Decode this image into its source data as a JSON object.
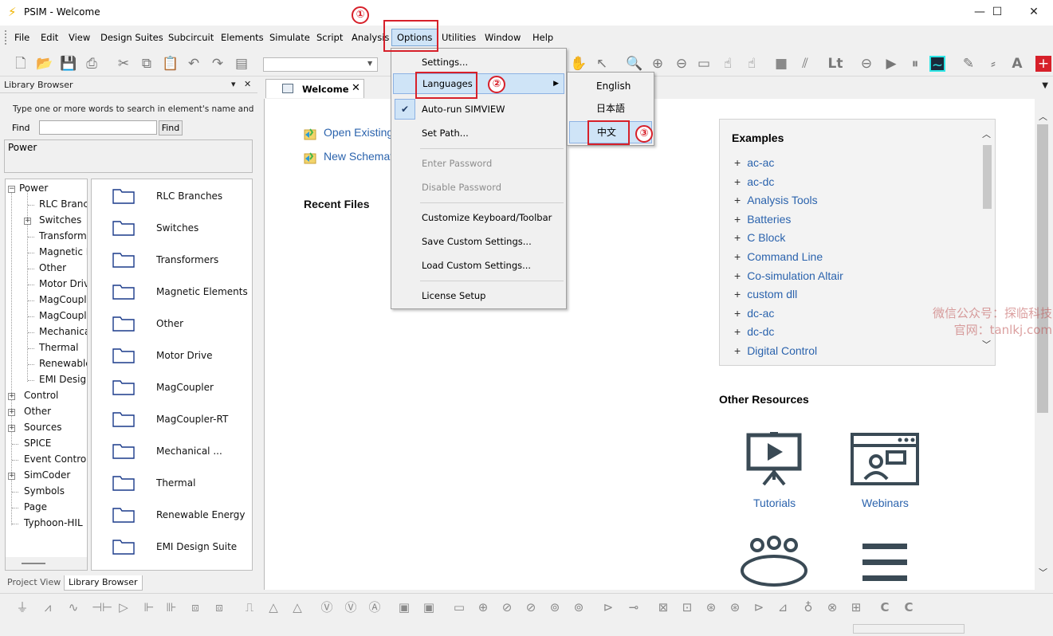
{
  "window": {
    "title": "PSIM - Welcome",
    "controls": {
      "minimize": "—",
      "maximize": "☐",
      "close": "✕"
    }
  },
  "menubar": {
    "items": [
      "File",
      "Edit",
      "View",
      "Design Suites",
      "Subcircuit",
      "Elements",
      "Simulate",
      "Script",
      "Analysis",
      "Options",
      "Utilities",
      "Window",
      "Help"
    ],
    "active": "Options"
  },
  "options_menu": {
    "items": [
      {
        "label": "Settings..."
      },
      {
        "label": "Languages",
        "has_submenu": true
      },
      {
        "label": "Auto-run SIMVIEW",
        "checked": true
      },
      {
        "label": "Set Path..."
      },
      {
        "label": "Enter Password",
        "disabled": true
      },
      {
        "label": "Disable Password",
        "disabled": true
      },
      {
        "label": "Customize Keyboard/Toolbar"
      },
      {
        "label": "Save Custom Settings..."
      },
      {
        "label": "Load Custom Settings..."
      },
      {
        "label": "License Setup"
      }
    ]
  },
  "languages_submenu": {
    "items": [
      "English",
      "日本語",
      "中文"
    ],
    "highlighted": "中文"
  },
  "annotations": {
    "step1": "①",
    "step2": "②",
    "step3": "③"
  },
  "library_browser": {
    "title": "Library Browser",
    "pin": "▾",
    "close": "✕",
    "search_hint": "Type one or more words to search in element's name and  desc",
    "find_label": "Find",
    "find_value": "",
    "find_button": "Find",
    "description": "Power",
    "tree": [
      {
        "label": "Power",
        "level": 0,
        "expander": "−"
      },
      {
        "label": "RLC Branches",
        "level": 1
      },
      {
        "label": "Switches",
        "level": 1,
        "expander": "+"
      },
      {
        "label": "Transformers",
        "level": 1
      },
      {
        "label": "Magnetic Elements",
        "level": 1
      },
      {
        "label": "Other",
        "level": 1
      },
      {
        "label": "Motor Drive",
        "level": 1
      },
      {
        "label": "MagCoupler",
        "level": 1
      },
      {
        "label": "MagCoupler-RT",
        "level": 1
      },
      {
        "label": "Mechanical",
        "level": 1
      },
      {
        "label": "Thermal",
        "level": 1
      },
      {
        "label": "Renewable Energy",
        "level": 1
      },
      {
        "label": "EMI Design Suite",
        "level": 1
      },
      {
        "label": "Control",
        "level": 0,
        "expander": "+"
      },
      {
        "label": "Other",
        "level": 0,
        "expander": "+"
      },
      {
        "label": "Sources",
        "level": 0,
        "expander": "+"
      },
      {
        "label": "SPICE",
        "level": 0
      },
      {
        "label": "Event Control",
        "level": 0
      },
      {
        "label": "SimCoder",
        "level": 0,
        "expander": "+"
      },
      {
        "label": "Symbols",
        "level": 0
      },
      {
        "label": "Page",
        "level": 0
      },
      {
        "label": "Typhoon-HIL",
        "level": 0
      }
    ],
    "folders": [
      "RLC Branches",
      "Switches",
      "Transformers",
      "Magnetic Elements",
      "Other",
      "Motor Drive",
      "MagCoupler",
      "MagCoupler-RT",
      "Mechanical ...",
      "Thermal",
      "Renewable Energy",
      "EMI Design Suite"
    ],
    "tabs": [
      "Project View",
      "Library Browser"
    ],
    "active_tab": "Library Browser"
  },
  "document_tab": {
    "label": "Welcome",
    "close": "✕"
  },
  "welcome": {
    "quick_links": [
      "Open Existing",
      "New Schemat"
    ],
    "recent_files_title": "Recent Files",
    "examples_title": "Examples",
    "examples": [
      "ac-ac",
      "ac-dc",
      "Analysis Tools",
      "Batteries",
      "C Block",
      "Command Line",
      "Co-simulation Altair",
      "custom dll",
      "dc-ac",
      "dc-dc",
      "Digital Control"
    ],
    "other_resources_title": "Other Resources",
    "resources": [
      "Tutorials",
      "Webinars"
    ]
  },
  "watermark": {
    "line1": "微信公众号：探临科技",
    "line2": "官网：tanlkj.com"
  },
  "colors": {
    "link": "#2b63ad",
    "annotation": "#d7202a",
    "menu_highlight": "#cfe4f7",
    "icon_dark": "#3a4a55"
  }
}
